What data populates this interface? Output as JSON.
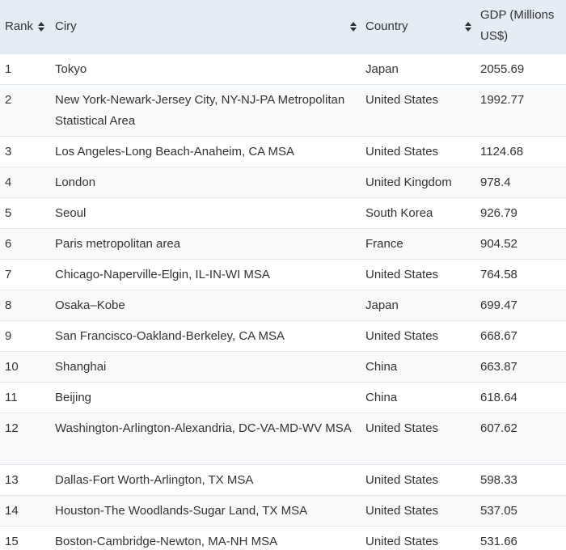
{
  "table": {
    "headers": {
      "rank": "Rank",
      "city": "Ciry",
      "country": "Country",
      "gdp": "GDP (Millions US$)"
    },
    "rows": [
      {
        "rank": "1",
        "city": "Tokyo",
        "country": "Japan",
        "gdp": "2055.69"
      },
      {
        "rank": "2",
        "city": "New York-Newark-Jersey City, NY-NJ-PA Metropolitan Statistical Area",
        "country": "United States",
        "gdp": "1992.77"
      },
      {
        "rank": "3",
        "city": "Los Angeles-Long Beach-Anaheim, CA MSA",
        "country": "United States",
        "gdp": "1124.68"
      },
      {
        "rank": "4",
        "city": "London",
        "country": "United Kingdom",
        "gdp": "978.4"
      },
      {
        "rank": "5",
        "city": "Seoul",
        "country": "South Korea",
        "gdp": "926.79"
      },
      {
        "rank": "6",
        "city": "Paris metropolitan area",
        "country": "France",
        "gdp": "904.52"
      },
      {
        "rank": "7",
        "city": "Chicago-Naperville-Elgin, IL-IN-WI MSA",
        "country": "United States",
        "gdp": "764.58"
      },
      {
        "rank": "8",
        "city": "Osaka–Kobe",
        "country": "Japan",
        "gdp": "699.47"
      },
      {
        "rank": "9",
        "city": "San Francisco-Oakland-Berkeley, CA MSA",
        "country": "United States",
        "gdp": "668.67"
      },
      {
        "rank": "10",
        "city": "Shanghai",
        "country": "China",
        "gdp": "663.87"
      },
      {
        "rank": "11",
        "city": "Beijing",
        "country": "China",
        "gdp": "618.64"
      },
      {
        "rank": "12",
        "city": "Washington-Arlington-Alexandria, DC-VA-MD-WV MSA",
        "country": "United States",
        "gdp": "607.62"
      },
      {
        "rank": "13",
        "city": "Dallas-Fort Worth-Arlington, TX MSA",
        "country": "United States",
        "gdp": "598.33"
      },
      {
        "rank": "14",
        "city": "Houston-The Woodlands-Sugar Land, TX MSA",
        "country": "United States",
        "gdp": "537.05"
      },
      {
        "rank": "15",
        "city": "Boston-Cambridge-Newton, MA-NH MSA",
        "country": "United States",
        "gdp": "531.66"
      }
    ]
  },
  "icons": {
    "sort": "sort-icon"
  },
  "colors": {
    "header_bg": "#e4ecf5",
    "row_alt_bg": "#f7f9fb",
    "text": "#333333"
  }
}
